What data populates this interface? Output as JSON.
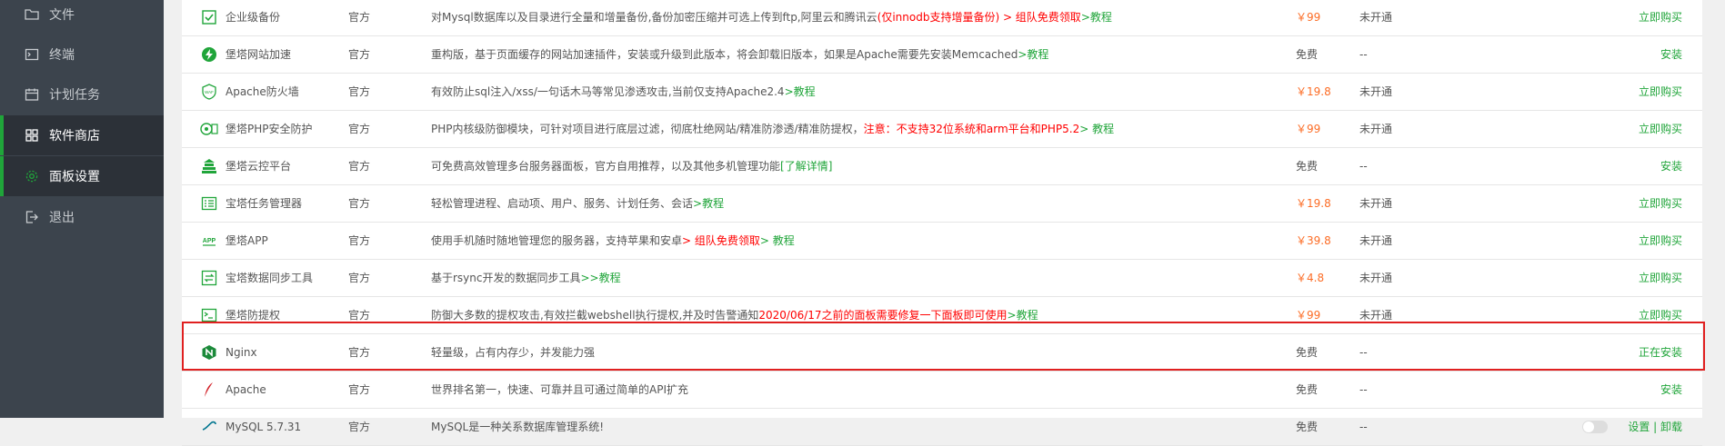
{
  "sidebar": {
    "items": [
      {
        "label": "文件",
        "icon": "folder-icon"
      },
      {
        "label": "终端",
        "icon": "terminal-icon"
      },
      {
        "label": "计划任务",
        "icon": "calendar-icon"
      },
      {
        "label": "软件商店",
        "icon": "grid-icon"
      },
      {
        "label": "面板设置",
        "icon": "gear-icon"
      },
      {
        "label": "退出",
        "icon": "logout-icon"
      }
    ]
  },
  "table": {
    "rows": [
      {
        "name": "企业级备份",
        "dev": "官方",
        "desc": [
          {
            "t": "对Mysql数据库以及目录进行全量和增量备份,备份加密压缩并可选上传到ftp,阿里云和腾讯云"
          },
          {
            "t": "(仅innodb支持增量备份) > 组队免费领取",
            "c": "red"
          },
          {
            "t": " >教程",
            "c": "green"
          }
        ],
        "price": "￥99",
        "price_red": true,
        "expire": "未开通",
        "action": "立即购买",
        "icon": "backup-icon"
      },
      {
        "name": "堡塔网站加速",
        "dev": "官方",
        "desc": [
          {
            "t": "重构版，基于页面缓存的网站加速插件，安装或升级到此版本，将会卸载旧版本，如果是Apache需要先安装Memcached"
          },
          {
            "t": " >教程",
            "c": "green"
          }
        ],
        "price": "免费",
        "price_red": false,
        "expire": "--",
        "action": "安装",
        "icon": "lightning-icon"
      },
      {
        "name": "Apache防火墙",
        "dev": "官方",
        "desc": [
          {
            "t": "有效防止sql注入/xss/一句话木马等常见渗透攻击,当前仅支持Apache2.4"
          },
          {
            "t": " >教程",
            "c": "green"
          }
        ],
        "price": "￥19.8",
        "price_red": true,
        "expire": "未开通",
        "action": "立即购买",
        "icon": "waf-icon"
      },
      {
        "name": "堡塔PHP安全防护",
        "dev": "官方",
        "desc": [
          {
            "t": "PHP内核级防御模块，可针对项目进行底层过滤，彻底杜绝网站/精准防渗透/精准防提权，"
          },
          {
            "t": "注意：不支持32位系统和arm平台和PHP5.2",
            "c": "red"
          },
          {
            "t": " > 教程",
            "c": "green"
          }
        ],
        "price": "￥99",
        "price_red": true,
        "expire": "未开通",
        "action": "立即购买",
        "icon": "php-shield-icon"
      },
      {
        "name": "堡塔云控平台",
        "dev": "官方",
        "desc": [
          {
            "t": "可免费高效管理多台服务器面板，官方自用推荐，以及其他多机管理功能 "
          },
          {
            "t": "[了解详情]",
            "c": "green"
          }
        ],
        "price": "免费",
        "price_red": false,
        "expire": "--",
        "action": "安装",
        "icon": "cloud-tower-icon"
      },
      {
        "name": "宝塔任务管理器",
        "dev": "官方",
        "desc": [
          {
            "t": "轻松管理进程、启动项、用户、服务、计划任务、会话"
          },
          {
            "t": " >教程",
            "c": "green"
          }
        ],
        "price": "￥19.8",
        "price_red": true,
        "expire": "未开通",
        "action": "立即购买",
        "icon": "task-list-icon"
      },
      {
        "name": "堡塔APP",
        "dev": "官方",
        "desc": [
          {
            "t": "使用手机随时随地管理您的服务器，支持苹果和安卓"
          },
          {
            "t": " > 组队免费领取",
            "c": "red"
          },
          {
            "t": " > 教程",
            "c": "green"
          }
        ],
        "price": "￥39.8",
        "price_red": true,
        "expire": "未开通",
        "action": "立即购买",
        "icon": "app-icon"
      },
      {
        "name": "宝塔数据同步工具",
        "dev": "官方",
        "desc": [
          {
            "t": "基于rsync开发的数据同步工具"
          },
          {
            "t": " >>教程",
            "c": "green"
          }
        ],
        "price": "￥4.8",
        "price_red": true,
        "expire": "未开通",
        "action": "立即购买",
        "icon": "sync-icon"
      },
      {
        "name": "堡塔防提权",
        "dev": "官方",
        "desc": [
          {
            "t": "防御大多数的提权攻击,有效拦截webshell执行提权,并及时告警通知"
          },
          {
            "t": "2020/06/17之前的面板需要修复一下面板即可使用",
            "c": "red"
          },
          {
            "t": " >教程",
            "c": "green"
          }
        ],
        "price": "￥99",
        "price_red": true,
        "expire": "未开通",
        "action": "立即购买",
        "icon": "terminal-shield-icon"
      },
      {
        "name": "Nginx",
        "dev": "官方",
        "desc": [
          {
            "t": "轻量级，占有内存少，并发能力强"
          }
        ],
        "price": "免费",
        "price_red": false,
        "expire": "--",
        "action": "正在安装",
        "icon": "nginx-icon"
      },
      {
        "name": "Apache",
        "dev": "官方",
        "desc": [
          {
            "t": "世界排名第一，快速、可靠并且可通过简单的API扩充"
          }
        ],
        "price": "免费",
        "price_red": false,
        "expire": "--",
        "action": "安装",
        "icon": "apache-feather-icon"
      },
      {
        "name": "MySQL 5.7.31",
        "dev": "官方",
        "desc": [
          {
            "t": "MySQL是一种关系数据库管理系统!"
          }
        ],
        "price": "免费",
        "price_red": false,
        "expire": "--",
        "action": "设置 | 卸载",
        "icon": "mysql-icon"
      }
    ]
  },
  "colors": {
    "accent": "#20a53a",
    "price": "#fc6d26",
    "alert": "#ff0000",
    "highlight_border": "#e02020"
  }
}
